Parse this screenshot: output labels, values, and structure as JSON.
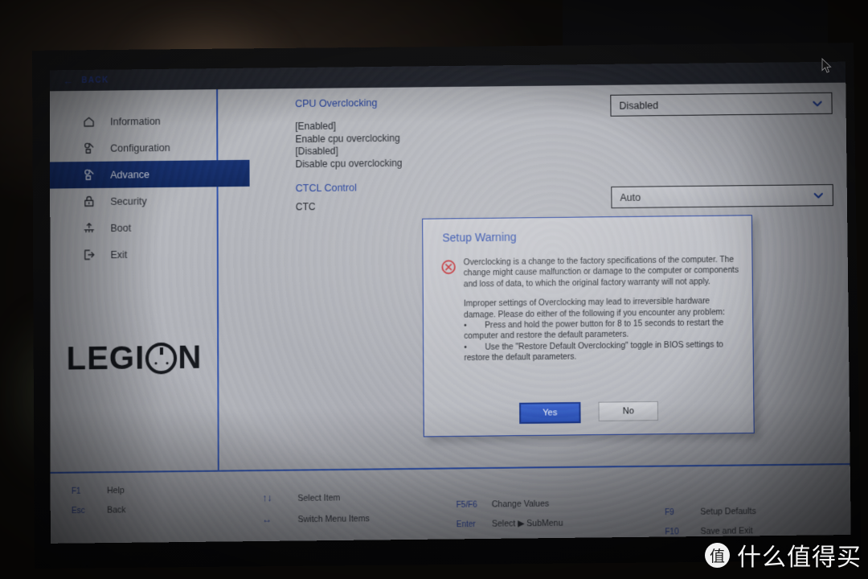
{
  "header": {
    "back_label": "BACK",
    "back_icon": "left-arrow-icon"
  },
  "sidebar": {
    "items": [
      {
        "label": "Information",
        "icon": "home-icon",
        "active": false
      },
      {
        "label": "Configuration",
        "icon": "configuration-icon",
        "active": false
      },
      {
        "label": "Advance",
        "icon": "advance-icon",
        "active": true
      },
      {
        "label": "Security",
        "icon": "lock-icon",
        "active": false
      },
      {
        "label": "Boot",
        "icon": "boot-icon",
        "active": false
      },
      {
        "label": "Exit",
        "icon": "exit-icon",
        "active": false
      }
    ],
    "brand": {
      "text_before": "LEGI",
      "text_after": "N"
    }
  },
  "content": {
    "settings": [
      {
        "label": "CPU Overclocking",
        "description": "[Enabled]\nEnable cpu overclocking\n[Disabled]\nDisable cpu overclocking",
        "value": "Disabled"
      },
      {
        "label": "CTCL Control",
        "description": "CTC",
        "value": "Auto"
      }
    ]
  },
  "dialog": {
    "title": "Setup Warning",
    "icon": "error-circle-x-icon",
    "paragraph1": "Overclocking is a change to the factory specifications of the computer. The change might cause malfunction or damage to the computer or components and loss of data, to which the original factory warranty will not apply.",
    "paragraph2": "Improper settings of Overclocking may lead to irreversible hardware damage. Please do either of the following if you encounter any problem:",
    "bullet1": "Press and hold the power button for 8 to 15 seconds to restart the computer and restore the default parameters.",
    "bullet2": "Use the \"Restore Default Overclocking\" toggle in BIOS settings to restore the default parameters.",
    "bullet_marker": "•",
    "yes_label": "Yes",
    "no_label": "No"
  },
  "footer": {
    "groups": [
      {
        "hotkeys": [
          {
            "key": "F1",
            "action": "Help"
          },
          {
            "key": "Esc",
            "action": "Back"
          }
        ]
      },
      {
        "hotkeys": [
          {
            "key": "↑↓",
            "action": "Select Item"
          },
          {
            "key": "↔",
            "action": "Switch Menu Items"
          }
        ]
      },
      {
        "hotkeys": [
          {
            "key": "F5/F6",
            "action": "Change Values"
          },
          {
            "key": "Enter",
            "action": "Select ▶ SubMenu"
          }
        ]
      },
      {
        "hotkeys": [
          {
            "key": "F9",
            "action": "Setup Defaults"
          },
          {
            "key": "F10",
            "action": "Save and Exit"
          }
        ]
      }
    ]
  },
  "watermark": {
    "badge": "值",
    "text": "什么值得买"
  },
  "colors": {
    "accent_blue": "#2e4fa8",
    "label_blue": "#25409a",
    "active_nav": "#17306e",
    "primary_button": "#2a4fb4",
    "error_red": "#c0262b",
    "screen_bg": "#b2b4ba"
  }
}
